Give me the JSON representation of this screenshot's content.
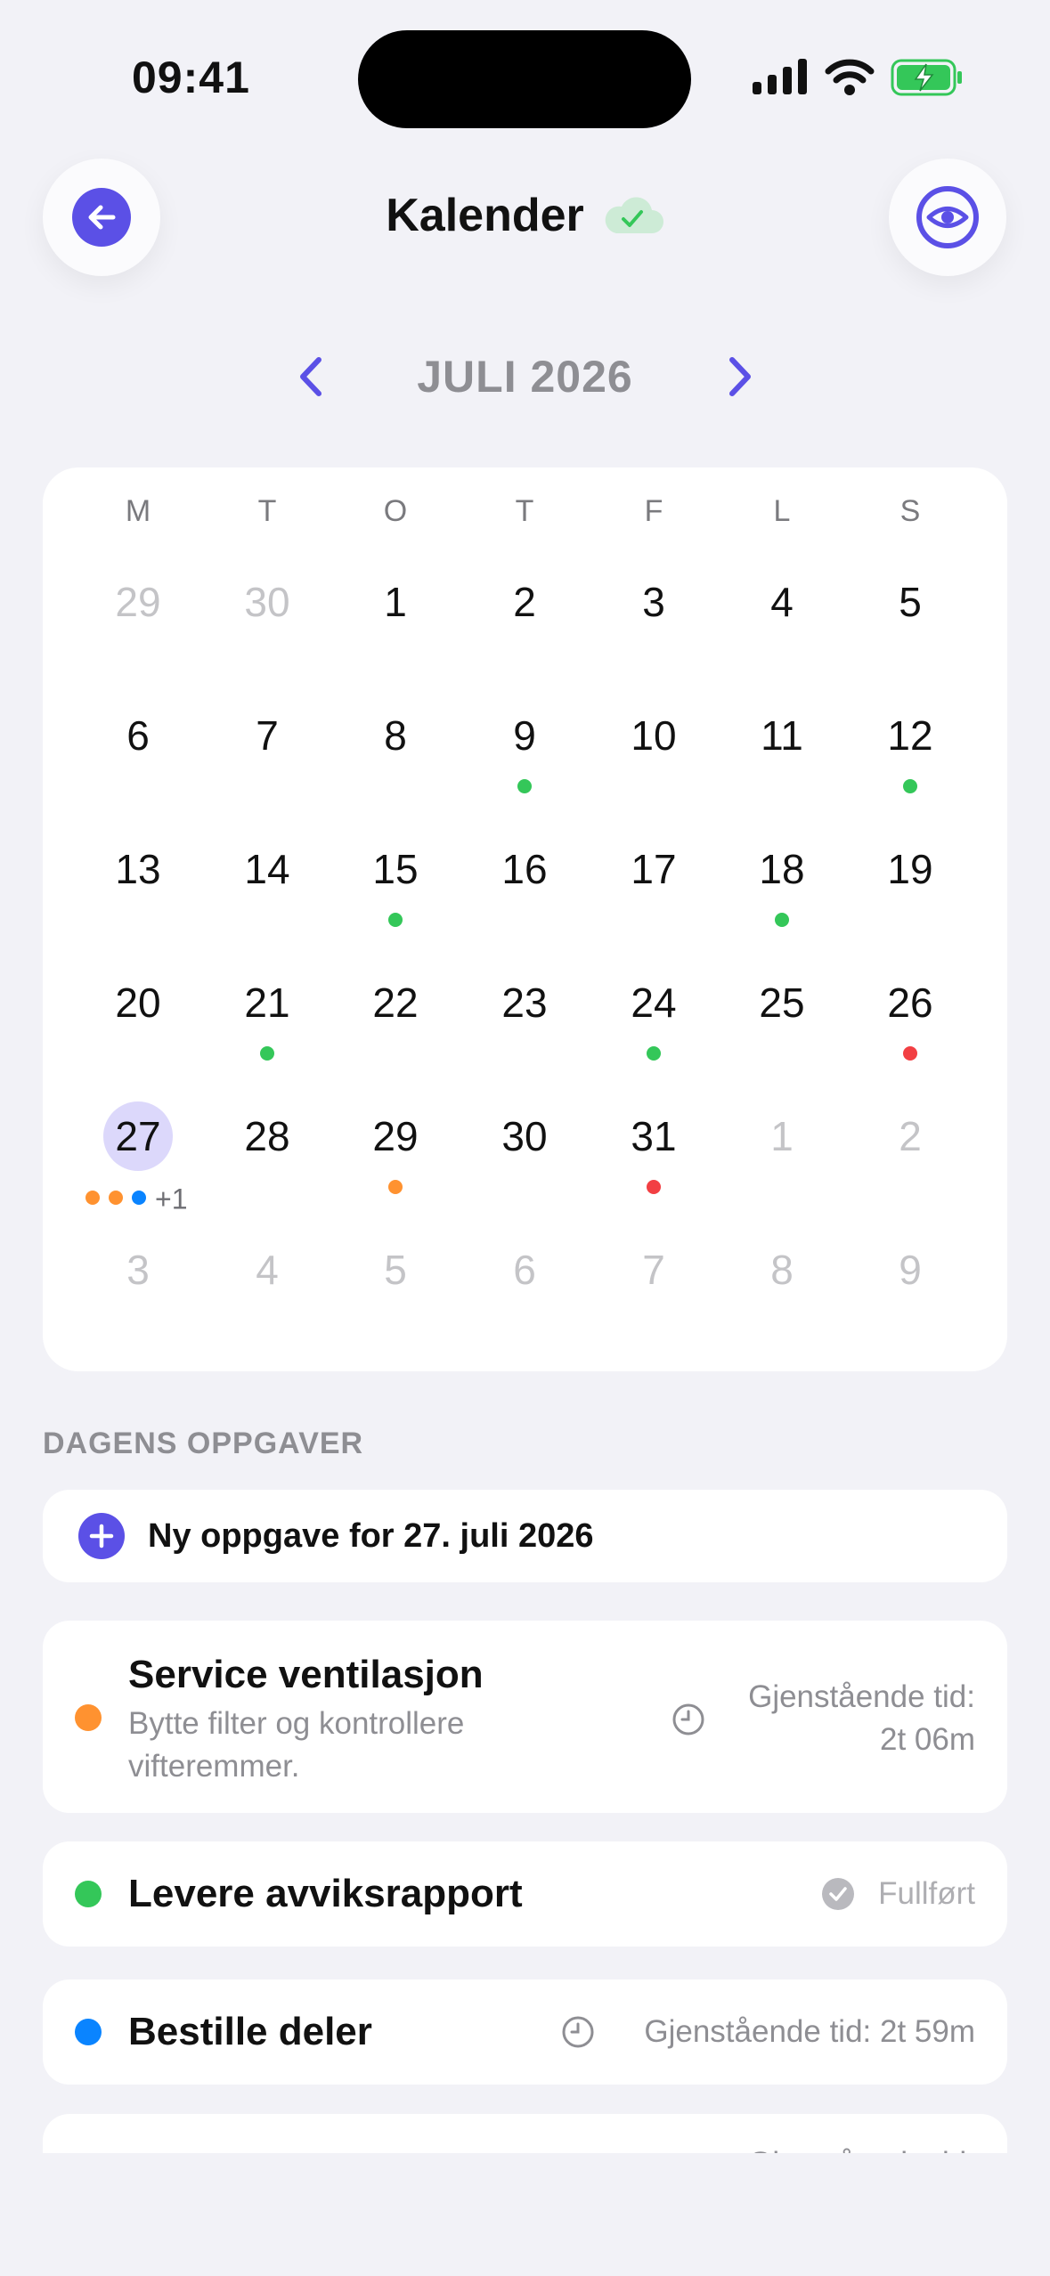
{
  "status_bar": {
    "time": "09:41"
  },
  "header": {
    "title": "Kalender"
  },
  "month": {
    "label": "JULI 2026"
  },
  "calendar": {
    "weekdays": [
      "M",
      "T",
      "O",
      "T",
      "F",
      "L",
      "S"
    ],
    "rows": [
      [
        "29",
        "30",
        "1",
        "2",
        "3",
        "4",
        "5"
      ],
      [
        "6",
        "7",
        "8",
        "9",
        "10",
        "11",
        "12"
      ],
      [
        "13",
        "14",
        "15",
        "16",
        "17",
        "18",
        "19"
      ],
      [
        "20",
        "21",
        "22",
        "23",
        "24",
        "25",
        "26"
      ],
      [
        "27",
        "28",
        "29",
        "30",
        "31",
        "1",
        "2"
      ],
      [
        "3",
        "4",
        "5",
        "6",
        "7",
        "8",
        "9"
      ]
    ],
    "today_more": "+1"
  },
  "section": {
    "title": "DAGENS OPPGAVER"
  },
  "new_task": {
    "label": "Ny oppgave for 27. juli 2026"
  },
  "tasks": [
    {
      "title": "Service ventilasjon",
      "subtitle": "Bytte filter og kontrollere vifteremmer.",
      "meta_line1": "Gjenstående tid:",
      "meta_line2": "2t 06m",
      "color": "#FF9230"
    },
    {
      "title": "Levere avviksrapport",
      "meta": "Fullført",
      "color": "#34C759"
    },
    {
      "title": "Bestille deler",
      "meta": "Gjenstående tid: 2t 59m",
      "color": "#0A84FF"
    },
    {
      "meta_partial": "Gjenstående tid:"
    }
  ],
  "colors": {
    "accent": "#5B50E6",
    "green": "#34C759",
    "red": "#F23F43",
    "orange": "#FF9230",
    "blue": "#0A84FF"
  }
}
